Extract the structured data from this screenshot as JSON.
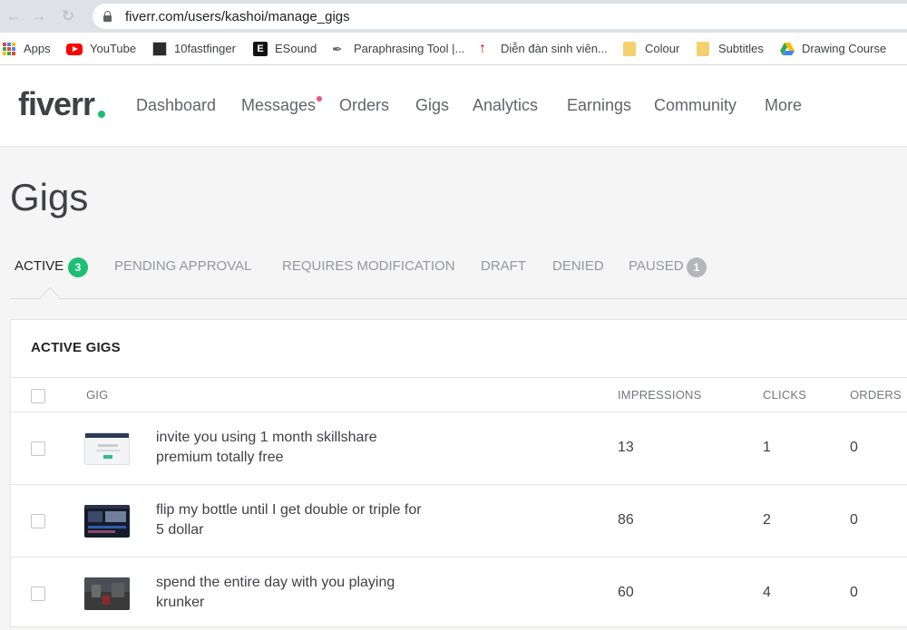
{
  "browser": {
    "url": "fiverr.com/users/kashoi/manage_gigs",
    "bookmarks": [
      {
        "label": "Apps",
        "icon": "apps-grid-icon"
      },
      {
        "label": "YouTube",
        "icon": "youtube-icon"
      },
      {
        "label": "10fastfinger",
        "icon": "tenfastfingers-icon"
      },
      {
        "label": "ESound",
        "icon": "esound-icon"
      },
      {
        "label": "Paraphrasing Tool |...",
        "icon": "feather-icon"
      },
      {
        "label": "Diễn đàn sinh viên...",
        "icon": "forum-icon"
      },
      {
        "label": "Colour",
        "icon": "folder-icon"
      },
      {
        "label": "Subtitles",
        "icon": "folder-icon"
      },
      {
        "label": "Drawing Course",
        "icon": "google-drive-icon"
      }
    ]
  },
  "header": {
    "logo": "fiverr",
    "nav": [
      "Dashboard",
      "Messages",
      "Orders",
      "Gigs",
      "Analytics",
      "Earnings",
      "Community",
      "More"
    ]
  },
  "page": {
    "title": "Gigs",
    "tabs": [
      {
        "label": "ACTIVE",
        "count": "3"
      },
      {
        "label": "PENDING APPROVAL"
      },
      {
        "label": "REQUIRES MODIFICATION"
      },
      {
        "label": "DRAFT"
      },
      {
        "label": "DENIED"
      },
      {
        "label": "PAUSED",
        "count": "1"
      }
    ]
  },
  "table": {
    "title": "ACTIVE GIGS",
    "columns": [
      "GIG",
      "IMPRESSIONS",
      "CLICKS",
      "ORDERS"
    ],
    "rows": [
      {
        "title": "invite you using 1 month skillshare premium totally free",
        "impressions": "13",
        "clicks": "1",
        "orders": "0"
      },
      {
        "title": "flip my bottle until I get double or triple for 5 dollar",
        "impressions": "86",
        "clicks": "2",
        "orders": "0"
      },
      {
        "title": "spend the entire day with you playing krunker",
        "impressions": "60",
        "clicks": "4",
        "orders": "0"
      }
    ]
  },
  "colors": {
    "brand_green": "#1dbf73",
    "active_badge": "#1dbf73",
    "paused_badge": "#b5b6ba",
    "notification_dot": "#e8567f"
  }
}
